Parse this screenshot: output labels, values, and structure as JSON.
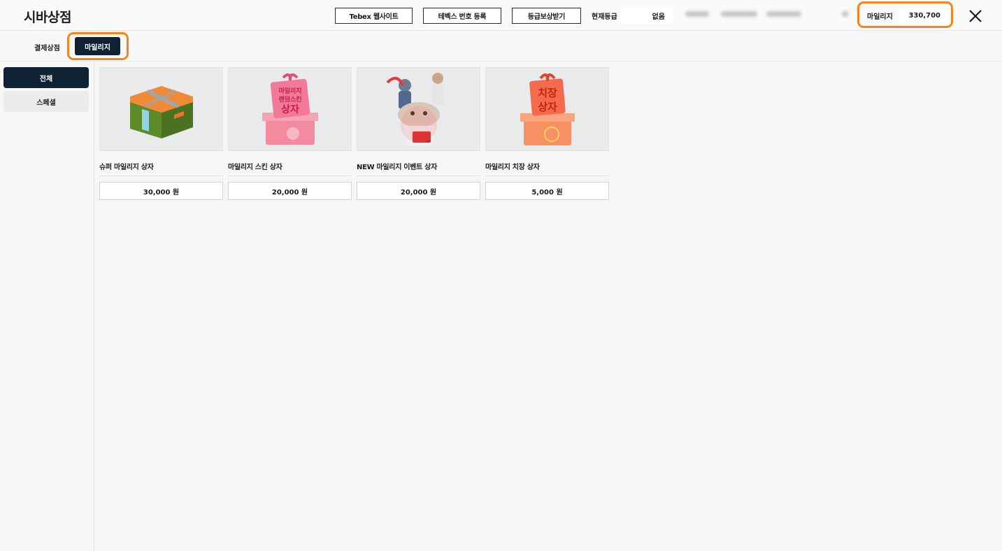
{
  "header": {
    "title": "시바상점",
    "buttons": [
      "Tebex 웹사이트",
      "테벡스 번호 등록",
      "등급보상받기"
    ],
    "grade_label": "현재등급",
    "grade_value": "없음",
    "mileage_label": "마일리지",
    "mileage_value": "330,700",
    "close_icon": "close-icon",
    "highlight_color": "#f7841b"
  },
  "tabs": {
    "items": [
      "결제상점",
      "마일리지"
    ],
    "active": "마일리지"
  },
  "sidebar": {
    "items": [
      "전체",
      "스페셜"
    ],
    "active": "전체"
  },
  "products": [
    {
      "name": "슈퍼 마일리지 상자",
      "price": "30,000 원"
    },
    {
      "name": "마일리지 스킨 상자",
      "price": "20,000 원"
    },
    {
      "name": "NEW 마일리지 이벤트 상자",
      "price": "20,000 원"
    },
    {
      "name": "마일리지 치장 상자",
      "price": "5,000 원"
    }
  ],
  "colors": {
    "accent_dark": "#0e2233",
    "highlight": "#f7841b"
  }
}
